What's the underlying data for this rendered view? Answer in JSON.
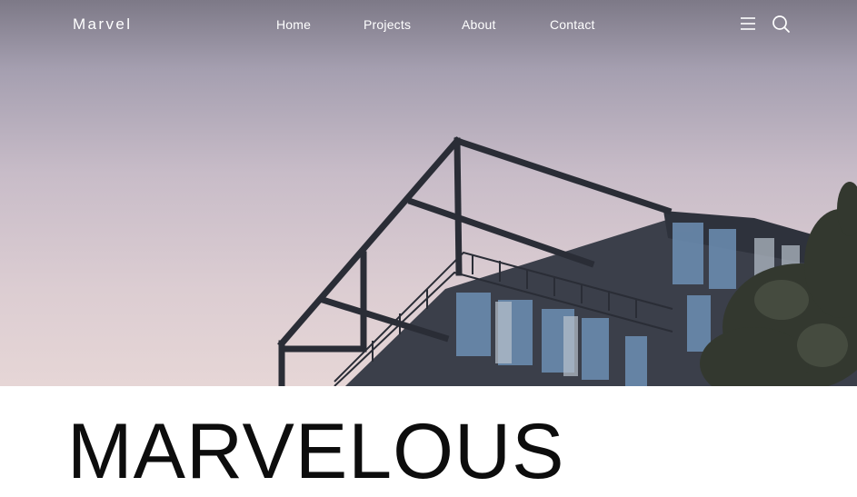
{
  "header": {
    "brand": "Marvel",
    "nav": [
      "Home",
      "Projects",
      "About",
      "Contact"
    ],
    "icons": {
      "menu": "hamburger-menu-icon",
      "search": "search-icon"
    }
  },
  "hero": {
    "image": "modern-glass-building-photo"
  },
  "headline": "MARVELOUS",
  "colors": {
    "nav_text": "#ffffff",
    "headline": "#0d0d0d",
    "sky_top": "#7d7987",
    "sky_bottom": "#e6d6d6",
    "structure": "#2a2d36"
  }
}
